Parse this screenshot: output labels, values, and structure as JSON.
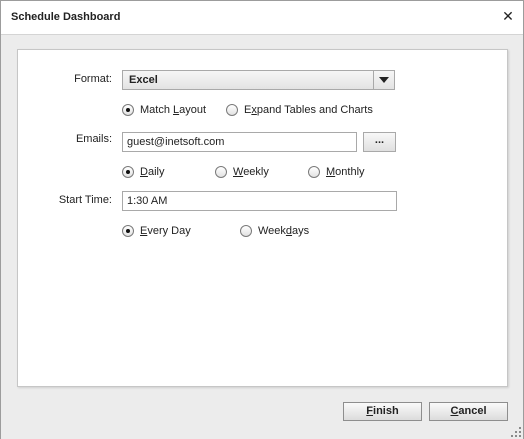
{
  "dialog": {
    "title": "Schedule Dashboard",
    "close_glyph": "✕"
  },
  "format": {
    "label": "Format:",
    "selected": "Excel",
    "options": [
      {
        "pre": "",
        "u": "",
        "post": "Match ",
        "u2": "L",
        "post2": "ayout",
        "selected": true
      },
      {
        "pre": "E",
        "u": "x",
        "post": "pand Tables and Charts",
        "selected": false
      }
    ]
  },
  "emails": {
    "label": "Emails:",
    "value": "guest@inetsoft.com",
    "browse_label": "...",
    "frequency": [
      {
        "u": "D",
        "rest": "aily",
        "selected": true
      },
      {
        "u": "W",
        "rest": "eekly",
        "selected": false
      },
      {
        "u": "M",
        "rest": "onthly",
        "selected": false
      }
    ]
  },
  "start_time": {
    "label": "Start Time:",
    "value": "1:30 AM",
    "days": [
      {
        "u": "E",
        "rest": "very Day",
        "selected": true
      },
      {
        "pre": "Week",
        "u": "d",
        "rest": "ays",
        "selected": false
      }
    ]
  },
  "footer": {
    "finish": {
      "u": "F",
      "rest": "inish"
    },
    "cancel": {
      "u": "C",
      "rest": "ancel"
    }
  }
}
